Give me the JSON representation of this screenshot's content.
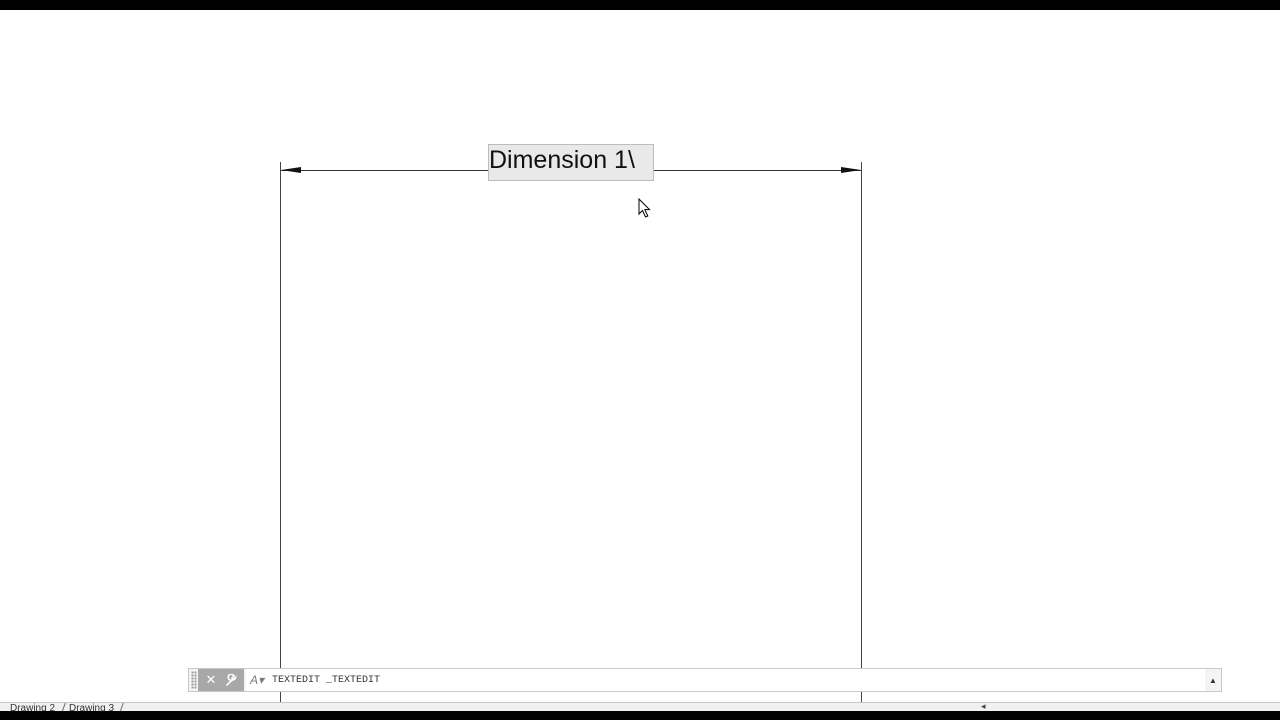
{
  "drawing": {
    "dimension_text": "Dimension 1\\"
  },
  "command_line": {
    "close_icon": "close-icon",
    "customize_icon": "wrench-icon",
    "prompt_icon": "prompt-icon",
    "text": "TEXTEDIT _TEXTEDIT",
    "expand_icon": "chevron-up-icon"
  },
  "layout_tabs": [
    {
      "label": "Drawing 2"
    },
    {
      "label": "Drawing 3"
    }
  ],
  "colors": {
    "background": "#ffffff",
    "text_box": "#e9e9e9",
    "command_buttons": "#a8a8a8"
  }
}
